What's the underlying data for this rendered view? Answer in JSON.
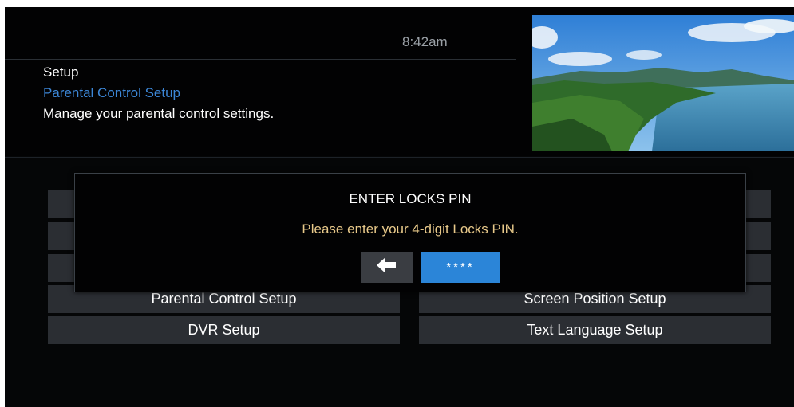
{
  "header": {
    "time": "8:42am",
    "breadcrumb_root": "Setup",
    "breadcrumb_current": "Parental Control Setup",
    "description": "Manage your parental control settings."
  },
  "menu": {
    "left": [
      "",
      "",
      "",
      "Parental Control Setup",
      "DVR Setup"
    ],
    "right": [
      "",
      "",
      "",
      "Screen Position Setup",
      "Text Language Setup"
    ]
  },
  "dialog": {
    "title": "ENTER LOCKS PIN",
    "message": "Please enter your 4-digit Locks PIN.",
    "back_icon": "left-arrow-icon",
    "pin_value": "****"
  },
  "colors": {
    "accent_blue": "#2b85d8",
    "breadcrumb_blue": "#3c86d6",
    "message_gold": "#e8c98a",
    "button_gray": "#2b2e33"
  }
}
